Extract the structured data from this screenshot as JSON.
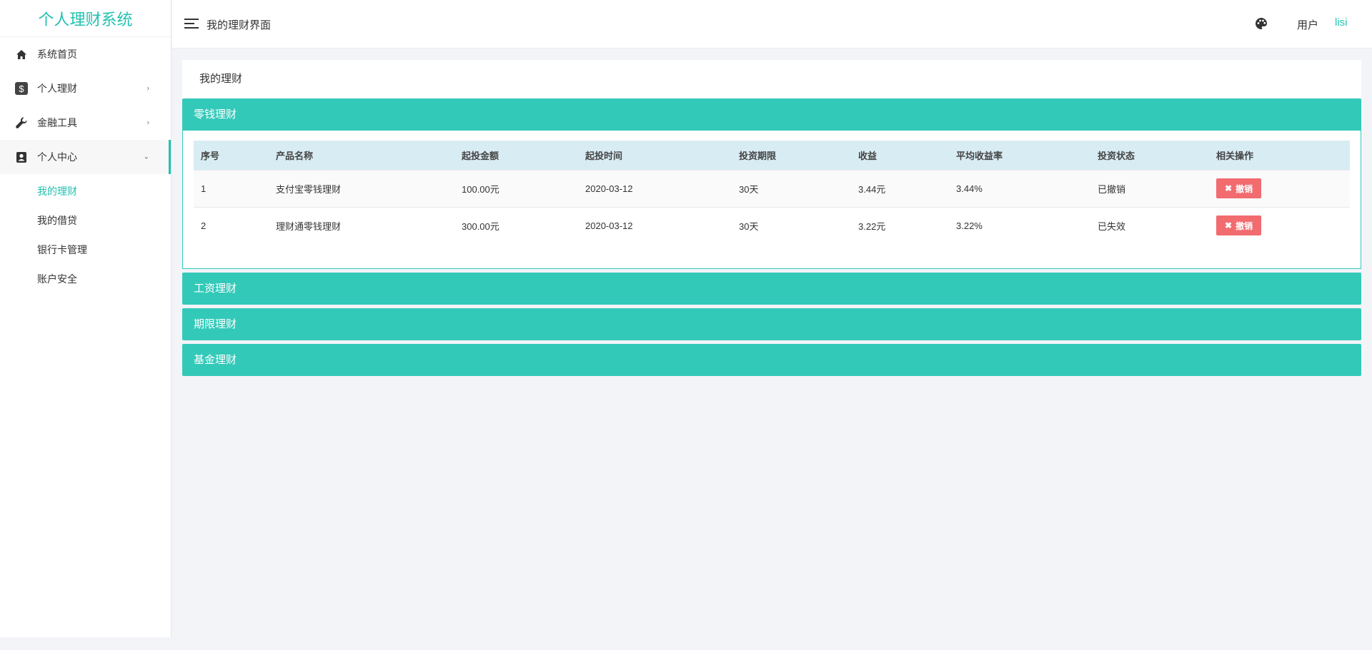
{
  "app": {
    "brand": "个人理财系统"
  },
  "sidebar": {
    "items": [
      {
        "label": "系统首页",
        "icon": "home-icon"
      },
      {
        "label": "个人理财",
        "icon": "dollar-icon"
      },
      {
        "label": "金融工具",
        "icon": "wrench-icon"
      },
      {
        "label": "个人中心",
        "icon": "user-card-icon"
      }
    ],
    "submenu": [
      "我的理财",
      "我的借贷",
      "银行卡管理",
      "账户安全"
    ]
  },
  "header": {
    "title": "我的理财界面",
    "user_label": "用户",
    "user_name": "lisi"
  },
  "main": {
    "card_title": "我的理财",
    "panels": [
      {
        "title": "零钱理财"
      },
      {
        "title": "工资理财"
      },
      {
        "title": "期限理财"
      },
      {
        "title": "基金理财"
      }
    ],
    "table": {
      "columns": [
        "序号",
        "产品名称",
        "起投金额",
        "起投时间",
        "投资期限",
        "收益",
        "平均收益率",
        "投资状态",
        "相关操作"
      ],
      "rows": [
        {
          "no": "1",
          "name": "支付宝零钱理财",
          "amount": "100.00元",
          "date": "2020-03-12",
          "term": "30天",
          "profit": "3.44元",
          "rate": "3.44%",
          "status": "已撤销",
          "action": "撤销"
        },
        {
          "no": "2",
          "name": "理财通零钱理财",
          "amount": "300.00元",
          "date": "2020-03-12",
          "term": "30天",
          "profit": "3.22元",
          "rate": "3.22%",
          "status": "已失效",
          "action": "撤销"
        }
      ]
    }
  },
  "colors": {
    "accent": "#22c1b0",
    "panel_header": "#33c9b9",
    "table_header": "#d8ecf3",
    "danger": "#f16b6f"
  }
}
